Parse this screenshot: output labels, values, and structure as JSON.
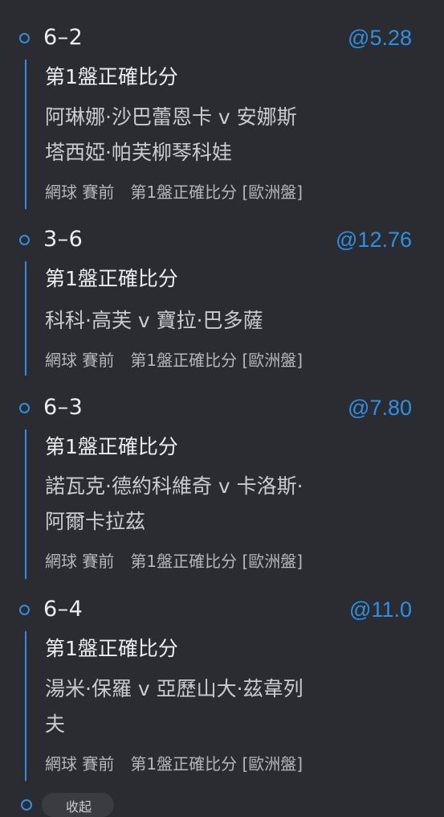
{
  "selections": [
    {
      "score": "6–2",
      "odds": "@5.28",
      "market": "第1盤正確比分",
      "event_lines": [
        "阿琳娜·沙巴蕾恩卡 v 安娜斯",
        "塔西婭·帕芙柳琴科娃"
      ],
      "meta": "網球 賽前　第1盤正確比分 [歐洲盤]"
    },
    {
      "score": "3–6",
      "odds": "@12.76",
      "market": "第1盤正確比分",
      "event_lines": [
        "科科·高芙 v 寶拉·巴多薩"
      ],
      "meta": "網球 賽前　第1盤正確比分 [歐洲盤]"
    },
    {
      "score": "6–3",
      "odds": "@7.80",
      "market": "第1盤正確比分",
      "event_lines": [
        "諾瓦克·德約科維奇 v 卡洛斯·",
        "阿爾卡拉茲"
      ],
      "meta": "網球 賽前　第1盤正確比分 [歐洲盤]"
    },
    {
      "score": "6–4",
      "odds": "@11.0",
      "market": "第1盤正確比分",
      "event_lines": [
        "湯米·保羅 v 亞歷山大·茲韋列",
        "夫"
      ],
      "meta": "網球 賽前　第1盤正確比分 [歐洲盤]"
    }
  ],
  "bottom_pill_label": "收起"
}
